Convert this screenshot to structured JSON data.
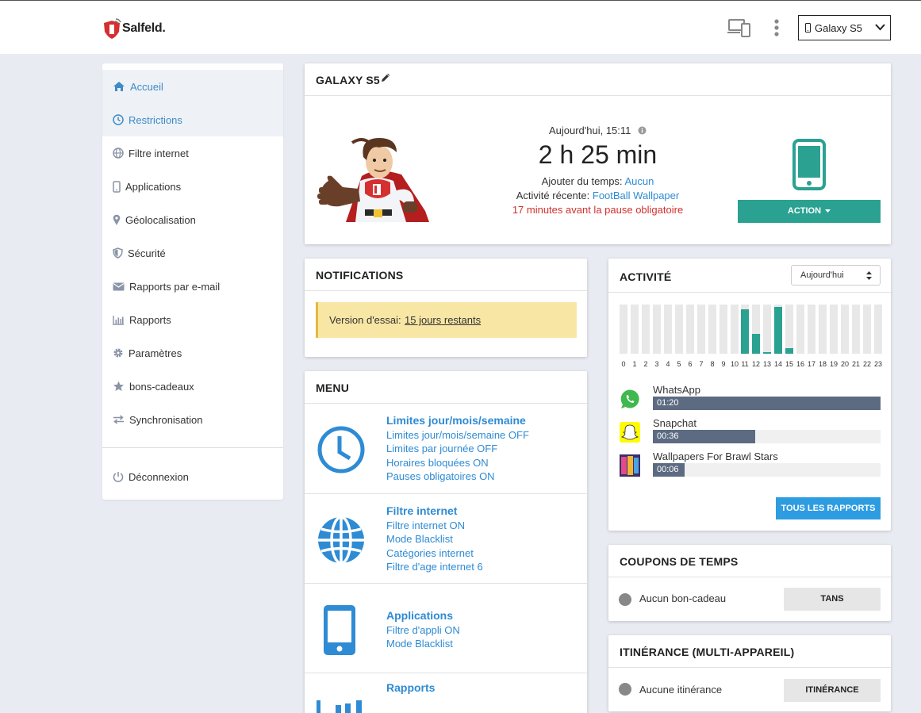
{
  "brand": {
    "name": "Salfeld."
  },
  "header": {
    "device_select": "Galaxy S5"
  },
  "sidebar": {
    "items": [
      {
        "label": "Accueil"
      },
      {
        "label": "Restrictions"
      },
      {
        "label": "Filtre internet"
      },
      {
        "label": "Applications"
      },
      {
        "label": "Géolocalisation"
      },
      {
        "label": "Sécurité"
      },
      {
        "label": "Rapports par e-mail"
      },
      {
        "label": "Rapports"
      },
      {
        "label": "Paramètres"
      },
      {
        "label": "bons-cadeaux"
      },
      {
        "label": "Synchronisation"
      }
    ],
    "logout": "Déconnexion"
  },
  "device_card": {
    "title": "GALAXY S5",
    "time_label": "Aujourd'hui, 15:11",
    "usage": "2 h 25 min",
    "add_time_label": "Ajouter du temps:",
    "add_time_value": "Aucun",
    "recent_label": "Activité récente:",
    "recent_value": "FootBall Wallpaper",
    "pause_warning": "17 minutes avant la pause obligatoire",
    "action_button": "ACTION"
  },
  "notifications": {
    "title": "NOTIFICATIONS",
    "trial_label": "Version d'essai:",
    "trial_link": "15 jours restants"
  },
  "menu": {
    "title": "MENU",
    "sections": [
      {
        "title": "Limites jour/mois/semaine",
        "items": [
          "Limites jour/mois/semaine OFF",
          "Limites par journée OFF",
          "Horaires bloquées ON",
          "Pauses obligatoires ON"
        ]
      },
      {
        "title": "Filtre internet",
        "items": [
          "Filtre internet ON",
          "Mode Blacklist",
          "Catégories internet",
          "Filtre d'age internet 6"
        ]
      },
      {
        "title": "Applications",
        "items": [
          "Filtre d'appli ON",
          "Mode Blacklist"
        ]
      },
      {
        "title": "Rapports",
        "items": []
      }
    ]
  },
  "activity": {
    "title": "ACTIVITÉ",
    "period_select": "Aujourd'hui",
    "hours": [
      "0",
      "1",
      "2",
      "3",
      "4",
      "5",
      "6",
      "7",
      "8",
      "9",
      "10",
      "11",
      "12",
      "13",
      "14",
      "15",
      "16",
      "17",
      "18",
      "19",
      "20",
      "21",
      "22",
      "23"
    ],
    "hourly_fraction": [
      0,
      0,
      0,
      0,
      0,
      0,
      0,
      0,
      0,
      0,
      0,
      0.9,
      0.4,
      0.02,
      0.95,
      0.12,
      0,
      0,
      0,
      0,
      0,
      0,
      0,
      0
    ],
    "apps": [
      {
        "name": "WhatsApp",
        "time": "01:20",
        "fraction": 1.0
      },
      {
        "name": "Snapchat",
        "time": "00:36",
        "fraction": 0.45
      },
      {
        "name": "Wallpapers For Brawl Stars",
        "time": "00:06",
        "fraction": 0.14
      }
    ],
    "all_reports_button": "TOUS LES RAPPORTS"
  },
  "coupons": {
    "title": "COUPONS DE TEMPS",
    "status": "Aucun bon-cadeau",
    "button": "TANS"
  },
  "roaming": {
    "title": "ITINÉRANCE (MULTI-APPAREIL)",
    "status": "Aucune itinérance",
    "button": "ITINÉRANCE"
  },
  "colors": {
    "teal": "#2aa191",
    "blue": "#2e9ce0",
    "link": "#2e8bd4",
    "warning_red": "#d0312d",
    "trial_bg": "#f8e6a5"
  }
}
